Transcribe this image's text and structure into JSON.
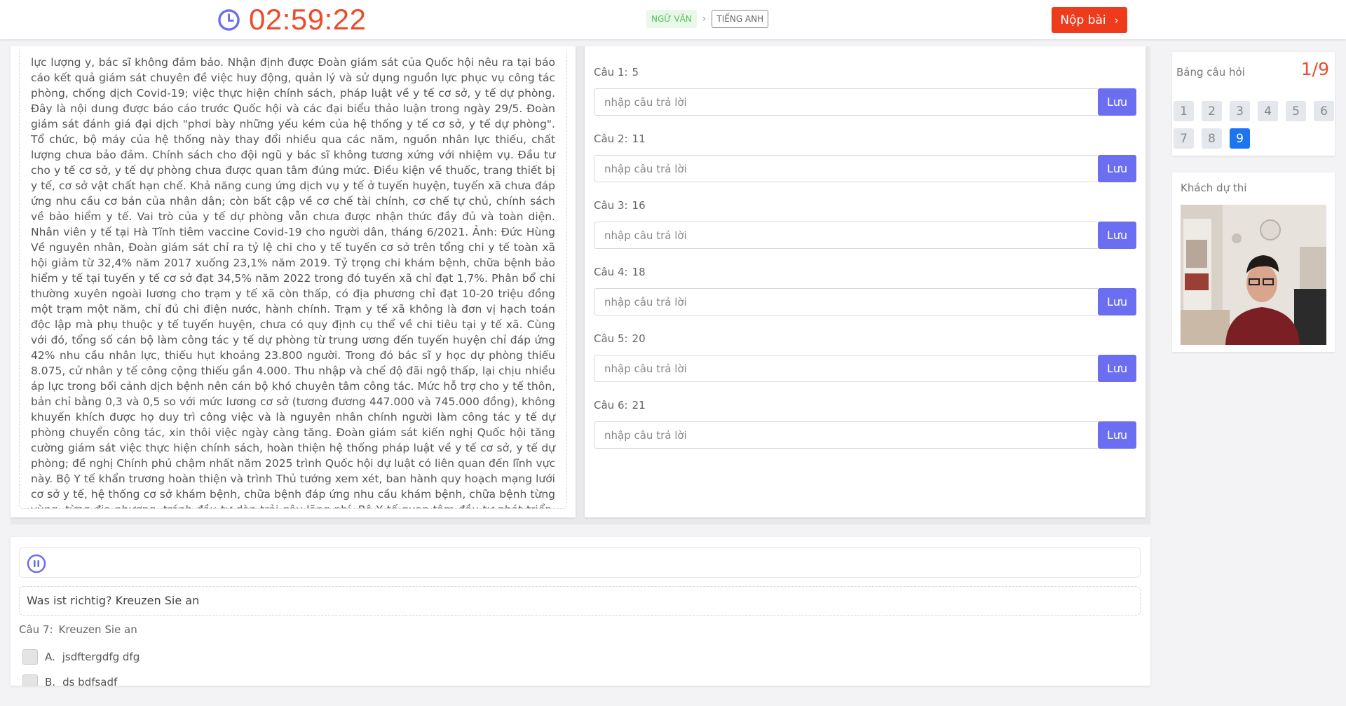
{
  "header": {
    "timer": "02:59:22",
    "subject_active": "NGỮ VĂN",
    "subject_next": "TIẾNG ANH",
    "submit_label": "Nộp bài"
  },
  "reading": {
    "text": "lực lượng y, bác sĩ không đảm bảo. Nhận định được Đoàn giám sát của Quốc hội nêu ra tại báo cáo kết quả giám sát chuyên đề việc huy động, quản lý và sử dụng nguồn lực phục vụ công tác phòng, chống dịch Covid-19; việc thực hiện chính sách, pháp luật về y tế cơ sở, y tế dự phòng. Đây là nội dung được báo cáo trước Quốc hội và các đại biểu thảo luận trong ngày 29/5. Đoàn giám sát đánh giá đại dịch \"phơi bày những yếu kém của hệ thống y tế cơ sở, y tế dự phòng\". Tổ chức, bộ máy của hệ thống này thay đổi nhiều qua các năm, nguồn nhân lực thiếu, chất lượng chưa bảo đảm. Chính sách cho đội ngũ y bác sĩ không tương xứng với nhiệm vụ. Đầu tư cho y tế cơ sở, y tế dự phòng chưa được quan tâm đúng mức. Điều kiện về thuốc, trang thiết bị y tế, cơ sở vật chất hạn chế. Khả năng cung ứng dịch vụ y tế ở tuyến huyện, tuyến xã chưa đáp ứng nhu cầu cơ bản của nhân dân; còn bất cập về cơ chế tài chính, cơ chế tự chủ, chính sách về bảo hiểm y tế. Vai trò của y tế dự phòng vẫn chưa được nhận thức đầy đủ và toàn diện. Nhân viên y tế tại Hà Tĩnh tiêm vaccine Covid-19 cho người dân, tháng 6/2021. Ảnh: Đức Hùng Về nguyên nhân, Đoàn giám sát chỉ ra tỷ lệ chi cho y tế tuyến cơ sở trên tổng chi y tế toàn xã hội giảm từ 32,4% năm 2017 xuống 23,1% năm 2019. Tỷ trọng chi khám bệnh, chữa bệnh bảo hiểm y tế tại tuyến y tế cơ sở đạt 34,5% năm 2022 trong đó tuyến xã chỉ đạt 1,7%. Phân bổ chi thường xuyên ngoài lương cho trạm y tế xã còn thấp, có địa phương chỉ đạt 10-20 triệu đồng một trạm một năm, chỉ đủ chi điện nước, hành chính. Trạm y tế xã không là đơn vị hạch toán độc lập mà phụ thuộc y tế tuyến huyện, chưa có quy định cụ thể về chi tiêu tại y tế xã. Cùng với đó, tổng số cán bộ làm công tác y tế dự phòng từ trung ương đến tuyến huyện chỉ đáp ứng 42% nhu cầu nhân lực, thiếu hụt khoảng 23.800 người. Trong đó bác sĩ y học dự phòng thiếu 8.075, cử nhân y tế công cộng thiếu gần 4.000. Thu nhập và chế độ đãi ngộ thấp, lại chịu nhiều áp lực trong bối cảnh dịch bệnh nên cán bộ khó chuyên tâm công tác. Mức hỗ trợ cho y tế thôn, bản chỉ bằng 0,3 và 0,5 so với mức lương cơ sở (tương đương 447.000 và 745.000 đồng), không khuyến khích được họ duy trì công việc và là nguyên nhân chính người làm công tác y tế dự phòng chuyển công tác, xin thôi việc ngày càng tăng. Đoàn giám sát kiến nghị Quốc hội tăng cường giám sát việc thực hiện chính sách, hoàn thiện hệ thống pháp luật về y tế cơ sở, y tế dự phòng; đề nghị Chính phủ chậm nhất năm 2025 trình Quốc hội dự luật có liên quan đến lĩnh vực này. Bộ Y tế khẩn trương hoàn thiện và trình Thủ tướng xem xét, ban hành quy hoạch mạng lưới cơ sở y tế, hệ thống cơ sở khám bệnh, chữa bệnh đáp ứng nhu cầu khám bệnh, chữa bệnh từng vùng, từng địa phương, tránh đầu tư dàn trải gây lãng phí. Bộ Y tế quan tâm đầu tư phát triển, nâng cao chất lượng y tế cơ sở thay vì chỉ tập trung đầu tư xây mới bệnh viện; phát triển mô hình bác sĩ gia đình, huy động sự tham gia của y tế tư nhân góp phần giảm tải tại các bệnh viện tuyến trên."
  },
  "answers": {
    "placeholder": "nhập câu trả lời",
    "save_label": "Lưu",
    "items": [
      {
        "label": "Câu 1:",
        "num": "5"
      },
      {
        "label": "Câu 2:",
        "num": "11"
      },
      {
        "label": "Câu 3:",
        "num": "16"
      },
      {
        "label": "Câu 4:",
        "num": "18"
      },
      {
        "label": "Câu 5:",
        "num": "20"
      },
      {
        "label": "Câu 6:",
        "num": "21"
      }
    ]
  },
  "listening": {
    "instruction": "Was ist richtig? Kreuzen Sie an",
    "question_label": "Câu 7:",
    "question_text": "Kreuzen Sie an",
    "options": [
      {
        "letter": "A.",
        "text": "jsdftergdfg dfg"
      },
      {
        "letter": "B.",
        "text": "ds bdfsadf"
      }
    ]
  },
  "question_board": {
    "title": "Bảng câu hỏi",
    "count": "1/9",
    "numbers": [
      "1",
      "2",
      "3",
      "4",
      "5",
      "6",
      "7",
      "8",
      "9"
    ],
    "active": "9"
  },
  "candidate": {
    "title": "Khách dự thi"
  },
  "colors": {
    "accent_red": "#ee3b1b",
    "save_purple": "#6b6ef0",
    "active_blue": "#1b74f0",
    "subject_green": "#55c05a"
  },
  "icons": {
    "timer": "clock-icon",
    "submit": "chevron-right-icon",
    "subject_separator": "chevron-right-icon",
    "media": "pause-icon"
  }
}
